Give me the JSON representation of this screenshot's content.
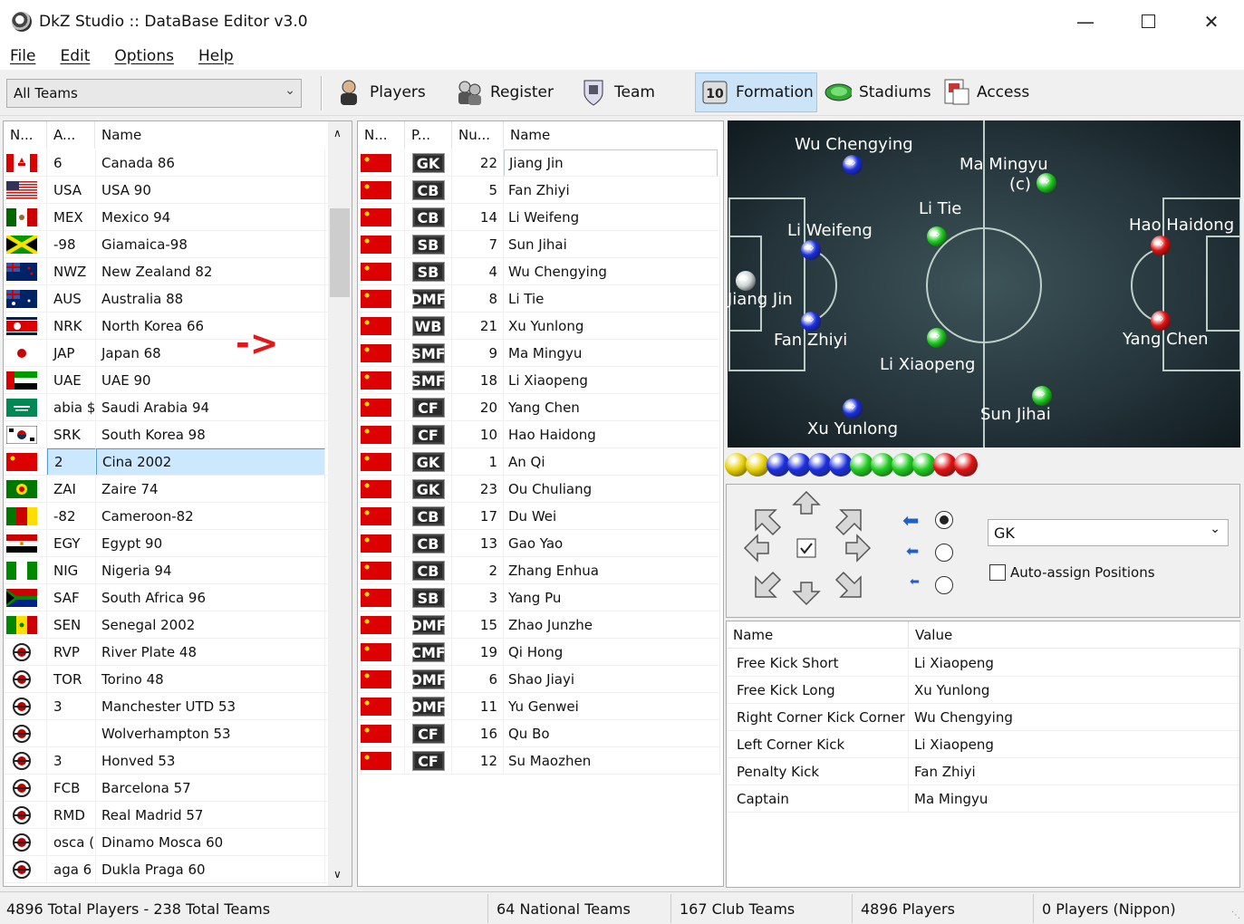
{
  "window": {
    "title": "DkZ Studio :: DataBase Editor v3.0"
  },
  "menu": [
    "File",
    "Edit",
    "Options",
    "Help"
  ],
  "toolbar": {
    "filter_value": "All Teams",
    "buttons": [
      {
        "label": "Players",
        "icon": "player-icon"
      },
      {
        "label": "Register",
        "icon": "register-icon"
      },
      {
        "label": "Team",
        "icon": "team-icon"
      },
      {
        "label": "Formation",
        "icon": "formation-icon",
        "active": true
      },
      {
        "label": "Stadiums",
        "icon": "stadium-icon"
      },
      {
        "label": "Access",
        "icon": "access-icon"
      }
    ]
  },
  "teams": {
    "headers": [
      "N...",
      "A...",
      "Name"
    ],
    "rows": [
      {
        "abbr": "6",
        "name": "Canada 86",
        "flag": "canada"
      },
      {
        "abbr": "USA",
        "name": "USA 90",
        "flag": "usa"
      },
      {
        "abbr": "MEX",
        "name": "Mexico 94",
        "flag": "mexico"
      },
      {
        "abbr": "-98",
        "name": "Giamaica-98",
        "flag": "jamaica"
      },
      {
        "abbr": "NWZ",
        "name": "New Zealand 82",
        "flag": "nz"
      },
      {
        "abbr": "AUS",
        "name": "Australia 88",
        "flag": "australia"
      },
      {
        "abbr": "NRK",
        "name": "North Korea 66",
        "flag": "nkorea"
      },
      {
        "abbr": "JAP",
        "name": "Japan 68",
        "flag": "japan"
      },
      {
        "abbr": "UAE",
        "name": "UAE 90",
        "flag": "uae"
      },
      {
        "abbr": "abia $",
        "name": "Saudi Arabia 94",
        "flag": "saudi"
      },
      {
        "abbr": "SRK",
        "name": "South Korea 98",
        "flag": "skorea"
      },
      {
        "abbr": "2",
        "name": "Cina 2002",
        "flag": "china",
        "selected": true
      },
      {
        "abbr": "ZAI",
        "name": "Zaire 74",
        "flag": "zaire"
      },
      {
        "abbr": "-82",
        "name": "Cameroon-82",
        "flag": "cameroon"
      },
      {
        "abbr": "EGY",
        "name": "Egypt 90",
        "flag": "egypt"
      },
      {
        "abbr": "NIG",
        "name": "Nigeria 94",
        "flag": "nigeria"
      },
      {
        "abbr": "SAF",
        "name": "South Africa 96",
        "flag": "safrica"
      },
      {
        "abbr": "SEN",
        "name": "Senegal 2002",
        "flag": "senegal"
      },
      {
        "abbr": "RVP",
        "name": "River Plate 48",
        "flag": "club"
      },
      {
        "abbr": "TOR",
        "name": "Torino 48",
        "flag": "club"
      },
      {
        "abbr": "3",
        "name": "Manchester UTD 53",
        "flag": "club"
      },
      {
        "abbr": "",
        "name": "Wolverhampton 53",
        "flag": "club"
      },
      {
        "abbr": "3",
        "name": "Honved 53",
        "flag": "club"
      },
      {
        "abbr": "FCB",
        "name": "Barcelona 57",
        "flag": "club"
      },
      {
        "abbr": "RMD",
        "name": "Real Madrid 57",
        "flag": "club"
      },
      {
        "abbr": "osca (",
        "name": "Dinamo Mosca 60",
        "flag": "club"
      },
      {
        "abbr": "aga 6",
        "name": "Dukla Praga 60",
        "flag": "club"
      }
    ]
  },
  "arrow_marker": "->",
  "players": {
    "headers": [
      "N...",
      "P...",
      "Nu...",
      "Name"
    ],
    "rows": [
      {
        "pos": "GK",
        "num": "22",
        "name": "Jiang Jin",
        "selected": true
      },
      {
        "pos": "CB",
        "num": "5",
        "name": "Fan Zhiyi"
      },
      {
        "pos": "CB",
        "num": "14",
        "name": "Li Weifeng"
      },
      {
        "pos": "SB",
        "num": "7",
        "name": "Sun Jihai"
      },
      {
        "pos": "SB",
        "num": "4",
        "name": "Wu Chengying"
      },
      {
        "pos": "DMF",
        "num": "8",
        "name": "Li Tie"
      },
      {
        "pos": "WB",
        "num": "21",
        "name": "Xu Yunlong"
      },
      {
        "pos": "SMF",
        "num": "9",
        "name": "Ma Mingyu"
      },
      {
        "pos": "SMF",
        "num": "18",
        "name": "Li Xiaopeng"
      },
      {
        "pos": "CF",
        "num": "20",
        "name": "Yang Chen"
      },
      {
        "pos": "CF",
        "num": "10",
        "name": "Hao Haidong"
      },
      {
        "pos": "GK",
        "num": "1",
        "name": "An Qi"
      },
      {
        "pos": "GK",
        "num": "23",
        "name": "Ou Chuliang"
      },
      {
        "pos": "CB",
        "num": "17",
        "name": "Du Wei"
      },
      {
        "pos": "CB",
        "num": "13",
        "name": "Gao Yao"
      },
      {
        "pos": "CB",
        "num": "2",
        "name": "Zhang Enhua"
      },
      {
        "pos": "SB",
        "num": "3",
        "name": "Yang Pu"
      },
      {
        "pos": "DMF",
        "num": "15",
        "name": "Zhao Junzhe"
      },
      {
        "pos": "CMF",
        "num": "19",
        "name": "Qi Hong"
      },
      {
        "pos": "OMF",
        "num": "6",
        "name": "Shao Jiayi"
      },
      {
        "pos": "OMF",
        "num": "11",
        "name": "Yu Genwei"
      },
      {
        "pos": "CF",
        "num": "16",
        "name": "Qu Bo"
      },
      {
        "pos": "CF",
        "num": "12",
        "name": "Su Maozhen"
      }
    ]
  },
  "pitch": {
    "labels": [
      "Wu Chengying",
      "Ma Mingyu",
      "(c)",
      "Li Tie",
      "Li Weifeng",
      "Hao Haidong",
      "Jiang Jin",
      "Fan Zhiyi",
      "Li Xiaopeng",
      "Yang Chen",
      "Xu Yunlong",
      "Sun Jihai"
    ]
  },
  "formation_balls": [
    "#e8d000",
    "#e8d000",
    "#1a2ee0",
    "#1a2ee0",
    "#1a2ee0",
    "#1a2ee0",
    "#1ecc1e",
    "#1ecc1e",
    "#1ecc1e",
    "#1ecc1e",
    "#e01010",
    "#e01010"
  ],
  "controls": {
    "position_value": "GK",
    "auto_assign_label": "Auto-assign Positions"
  },
  "kv": {
    "headers": [
      "Name",
      "Value"
    ],
    "rows": [
      {
        "name": "Free Kick Short",
        "value": "Li Xiaopeng"
      },
      {
        "name": "Free Kick Long",
        "value": "Xu Yunlong"
      },
      {
        "name": "Right Corner Kick Corner",
        "value": "Wu Chengying"
      },
      {
        "name": "Left Corner Kick",
        "value": "Li Xiaopeng"
      },
      {
        "name": "Penalty Kick",
        "value": "Fan Zhiyi"
      },
      {
        "name": "Captain",
        "value": "Ma Mingyu"
      }
    ]
  },
  "status": [
    "4896 Total Players  -  238 Total Teams",
    "64 National Teams",
    "167 Club Teams",
    "4896 Players",
    "0 Players (Nippon)"
  ]
}
